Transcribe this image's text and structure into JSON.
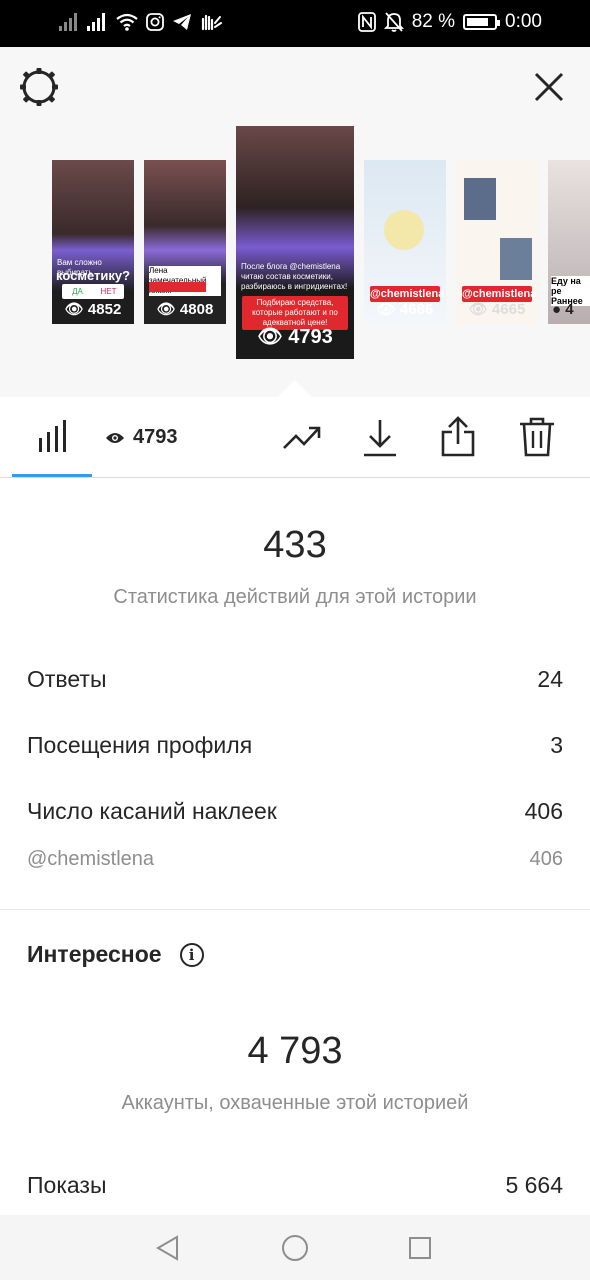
{
  "status_bar": {
    "battery_percent": "82 %",
    "time": "0:00",
    "battery_level": 0.82,
    "icons": [
      "signal-icon",
      "signal-icon",
      "wifi-icon",
      "instagram-icon",
      "telegram-icon",
      "hand-wave-icon",
      "nfc-icon",
      "mute-icon"
    ]
  },
  "header": {
    "settings_icon": "gear-icon",
    "close_icon": "close-icon"
  },
  "stories": [
    {
      "views": "4852",
      "caption": "Вам сложно выбирать",
      "headline": "косметику?",
      "poll": [
        "ДА",
        "НЕТ"
      ]
    },
    {
      "views": "4808",
      "caption": "Лена замечательный химик"
    },
    {
      "views": "4793",
      "caption": "После блога @chemistlena читаю состав косметики, разбираюсь в ингридиентах!",
      "tag": "Подбираю средства, которые работают и по адекватной цене!",
      "selected": true
    },
    {
      "views": "4686",
      "tag": "@chemistlena"
    },
    {
      "views": "4665",
      "tag": "@chemistlena"
    },
    {
      "views": "4",
      "caption": "Еду на ре Раннее"
    }
  ],
  "toolbar": {
    "stats_icon": "bar-chart-icon",
    "views_icon": "eye-icon",
    "views": "4793",
    "trend_icon": "trending-up-icon",
    "download_icon": "download-icon",
    "share_icon": "share-icon",
    "delete_icon": "trash-icon"
  },
  "actions": {
    "total": "433",
    "label": "Статистика действий для этой истории",
    "rows": [
      {
        "label": "Ответы",
        "value": "24"
      },
      {
        "label": "Посещения профиля",
        "value": "3"
      },
      {
        "label": "Число касаний наклеек",
        "value": "406"
      }
    ],
    "sub_row": {
      "label": "@chemistlena",
      "value": "406"
    }
  },
  "discovery": {
    "title": "Интересное",
    "info_icon": "info-icon",
    "total": "4 793",
    "label": "Аккаунты, охваченные этой историей",
    "rows": [
      {
        "label": "Показы",
        "value": "5 664"
      }
    ]
  },
  "nav": {
    "back_icon": "back-triangle-icon",
    "home_icon": "home-circle-icon",
    "recents_icon": "recents-square-icon"
  }
}
